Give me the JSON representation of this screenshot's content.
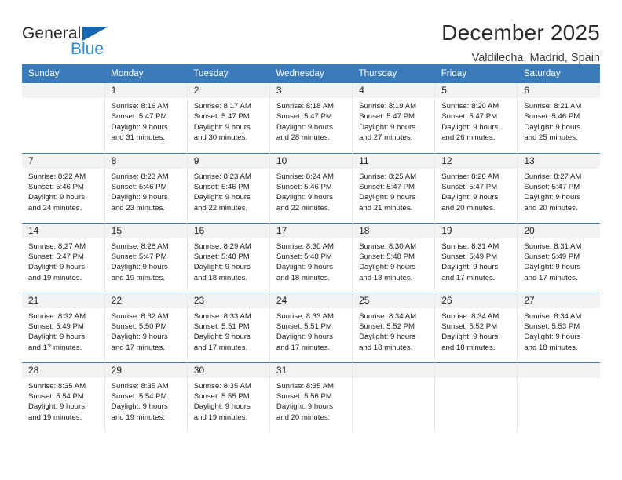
{
  "brand": {
    "name_part1": "General",
    "name_part2": "Blue",
    "accent": "#1667b1",
    "accent_light": "#2e8bd8"
  },
  "header": {
    "title": "December 2025",
    "location": "Valdilecha, Madrid, Spain"
  },
  "calendar": {
    "header_bg": "#3a7cbb",
    "weekdays": [
      "Sunday",
      "Monday",
      "Tuesday",
      "Wednesday",
      "Thursday",
      "Friday",
      "Saturday"
    ],
    "weeks": [
      [
        {
          "day": "",
          "lines": []
        },
        {
          "day": "1",
          "lines": [
            "Sunrise: 8:16 AM",
            "Sunset: 5:47 PM",
            "Daylight: 9 hours",
            "and 31 minutes."
          ]
        },
        {
          "day": "2",
          "lines": [
            "Sunrise: 8:17 AM",
            "Sunset: 5:47 PM",
            "Daylight: 9 hours",
            "and 30 minutes."
          ]
        },
        {
          "day": "3",
          "lines": [
            "Sunrise: 8:18 AM",
            "Sunset: 5:47 PM",
            "Daylight: 9 hours",
            "and 28 minutes."
          ]
        },
        {
          "day": "4",
          "lines": [
            "Sunrise: 8:19 AM",
            "Sunset: 5:47 PM",
            "Daylight: 9 hours",
            "and 27 minutes."
          ]
        },
        {
          "day": "5",
          "lines": [
            "Sunrise: 8:20 AM",
            "Sunset: 5:47 PM",
            "Daylight: 9 hours",
            "and 26 minutes."
          ]
        },
        {
          "day": "6",
          "lines": [
            "Sunrise: 8:21 AM",
            "Sunset: 5:46 PM",
            "Daylight: 9 hours",
            "and 25 minutes."
          ]
        }
      ],
      [
        {
          "day": "7",
          "lines": [
            "Sunrise: 8:22 AM",
            "Sunset: 5:46 PM",
            "Daylight: 9 hours",
            "and 24 minutes."
          ]
        },
        {
          "day": "8",
          "lines": [
            "Sunrise: 8:23 AM",
            "Sunset: 5:46 PM",
            "Daylight: 9 hours",
            "and 23 minutes."
          ]
        },
        {
          "day": "9",
          "lines": [
            "Sunrise: 8:23 AM",
            "Sunset: 5:46 PM",
            "Daylight: 9 hours",
            "and 22 minutes."
          ]
        },
        {
          "day": "10",
          "lines": [
            "Sunrise: 8:24 AM",
            "Sunset: 5:46 PM",
            "Daylight: 9 hours",
            "and 22 minutes."
          ]
        },
        {
          "day": "11",
          "lines": [
            "Sunrise: 8:25 AM",
            "Sunset: 5:47 PM",
            "Daylight: 9 hours",
            "and 21 minutes."
          ]
        },
        {
          "day": "12",
          "lines": [
            "Sunrise: 8:26 AM",
            "Sunset: 5:47 PM",
            "Daylight: 9 hours",
            "and 20 minutes."
          ]
        },
        {
          "day": "13",
          "lines": [
            "Sunrise: 8:27 AM",
            "Sunset: 5:47 PM",
            "Daylight: 9 hours",
            "and 20 minutes."
          ]
        }
      ],
      [
        {
          "day": "14",
          "lines": [
            "Sunrise: 8:27 AM",
            "Sunset: 5:47 PM",
            "Daylight: 9 hours",
            "and 19 minutes."
          ]
        },
        {
          "day": "15",
          "lines": [
            "Sunrise: 8:28 AM",
            "Sunset: 5:47 PM",
            "Daylight: 9 hours",
            "and 19 minutes."
          ]
        },
        {
          "day": "16",
          "lines": [
            "Sunrise: 8:29 AM",
            "Sunset: 5:48 PM",
            "Daylight: 9 hours",
            "and 18 minutes."
          ]
        },
        {
          "day": "17",
          "lines": [
            "Sunrise: 8:30 AM",
            "Sunset: 5:48 PM",
            "Daylight: 9 hours",
            "and 18 minutes."
          ]
        },
        {
          "day": "18",
          "lines": [
            "Sunrise: 8:30 AM",
            "Sunset: 5:48 PM",
            "Daylight: 9 hours",
            "and 18 minutes."
          ]
        },
        {
          "day": "19",
          "lines": [
            "Sunrise: 8:31 AM",
            "Sunset: 5:49 PM",
            "Daylight: 9 hours",
            "and 17 minutes."
          ]
        },
        {
          "day": "20",
          "lines": [
            "Sunrise: 8:31 AM",
            "Sunset: 5:49 PM",
            "Daylight: 9 hours",
            "and 17 minutes."
          ]
        }
      ],
      [
        {
          "day": "21",
          "lines": [
            "Sunrise: 8:32 AM",
            "Sunset: 5:49 PM",
            "Daylight: 9 hours",
            "and 17 minutes."
          ]
        },
        {
          "day": "22",
          "lines": [
            "Sunrise: 8:32 AM",
            "Sunset: 5:50 PM",
            "Daylight: 9 hours",
            "and 17 minutes."
          ]
        },
        {
          "day": "23",
          "lines": [
            "Sunrise: 8:33 AM",
            "Sunset: 5:51 PM",
            "Daylight: 9 hours",
            "and 17 minutes."
          ]
        },
        {
          "day": "24",
          "lines": [
            "Sunrise: 8:33 AM",
            "Sunset: 5:51 PM",
            "Daylight: 9 hours",
            "and 17 minutes."
          ]
        },
        {
          "day": "25",
          "lines": [
            "Sunrise: 8:34 AM",
            "Sunset: 5:52 PM",
            "Daylight: 9 hours",
            "and 18 minutes."
          ]
        },
        {
          "day": "26",
          "lines": [
            "Sunrise: 8:34 AM",
            "Sunset: 5:52 PM",
            "Daylight: 9 hours",
            "and 18 minutes."
          ]
        },
        {
          "day": "27",
          "lines": [
            "Sunrise: 8:34 AM",
            "Sunset: 5:53 PM",
            "Daylight: 9 hours",
            "and 18 minutes."
          ]
        }
      ],
      [
        {
          "day": "28",
          "lines": [
            "Sunrise: 8:35 AM",
            "Sunset: 5:54 PM",
            "Daylight: 9 hours",
            "and 19 minutes."
          ]
        },
        {
          "day": "29",
          "lines": [
            "Sunrise: 8:35 AM",
            "Sunset: 5:54 PM",
            "Daylight: 9 hours",
            "and 19 minutes."
          ]
        },
        {
          "day": "30",
          "lines": [
            "Sunrise: 8:35 AM",
            "Sunset: 5:55 PM",
            "Daylight: 9 hours",
            "and 19 minutes."
          ]
        },
        {
          "day": "31",
          "lines": [
            "Sunrise: 8:35 AM",
            "Sunset: 5:56 PM",
            "Daylight: 9 hours",
            "and 20 minutes."
          ]
        },
        {
          "day": "",
          "lines": []
        },
        {
          "day": "",
          "lines": []
        },
        {
          "day": "",
          "lines": []
        }
      ]
    ]
  }
}
